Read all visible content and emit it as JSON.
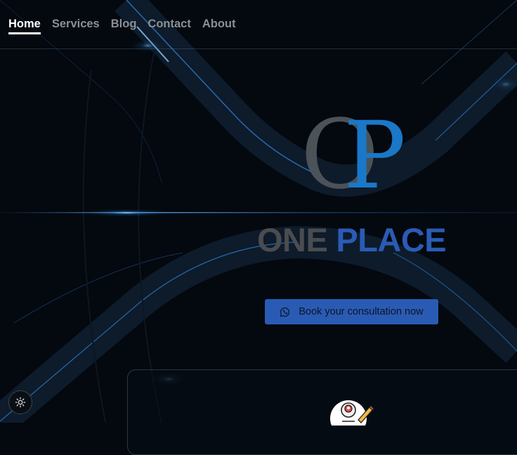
{
  "nav": {
    "items": [
      {
        "label": "Home",
        "active": true
      },
      {
        "label": "Services",
        "active": false
      },
      {
        "label": "Blog",
        "active": false
      },
      {
        "label": "Contact",
        "active": false
      },
      {
        "label": "About",
        "active": false
      }
    ]
  },
  "hero": {
    "monogram": {
      "first": "O",
      "second": "P"
    },
    "brand": {
      "word1": "ONE",
      "word2": "PLACE"
    },
    "cta_label": "Book your consultation now",
    "cta_icon": "whatsapp-icon"
  },
  "colors": {
    "background": "#04080f",
    "accent_blue": "#2a5bb4",
    "monogram_blue": "#1a78c8",
    "monogram_gray": "#4b5258",
    "brand_gray": "#4a4c4f"
  },
  "theme_toggle_icon": "sun-icon"
}
